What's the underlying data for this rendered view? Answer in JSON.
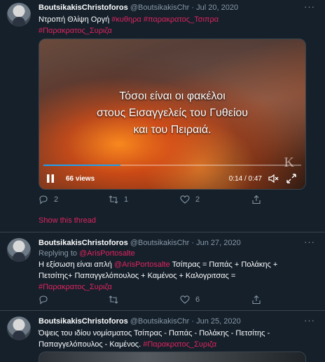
{
  "tweets": [
    {
      "name": "BoutsikakisChristoforos",
      "handle": "@BoutsikakisChr",
      "sep": "·",
      "date": "Jul 20, 2020",
      "text_plain": "Ντροπή Θλίψη Οργή ",
      "tags_line1": "#κυθηρα #παρακρατος_Τσιπρα",
      "tags_line2": "#Παρακρατος_Συριζα",
      "video": {
        "overlay_line1": "Τόσοι είναι οι φακέλοι",
        "overlay_line2": "στους Εισαγγελείς του Γυθείου",
        "overlay_line3": "και του Πειραιά.",
        "views": "66 views",
        "time": "0:14 / 0:47",
        "watermark": "K",
        "progress": 0.3
      },
      "replies": "2",
      "retweets": "1",
      "likes": "2",
      "show_thread": "Show this thread"
    },
    {
      "name": "BoutsikakisChristoforos",
      "handle": "@BoutsikakisChr",
      "sep": "·",
      "date": "Jun 27, 2020",
      "replying_prefix": "Replying to ",
      "replying_to": "@ArisPortosalte",
      "text_a": "Η εξίσωση είναι απλή ",
      "text_mention": "@ArisPortosalte",
      "text_b": " Τσίπρας = Παπάς + Πολάκης +",
      "text_line2": "Πετσίτης+ Παπαγγελόπουλος + Καμένος + Καλογριτσας =",
      "text_tag": "#Παρακρατος_Συριζα",
      "replies": "",
      "retweets": "",
      "likes": "6"
    },
    {
      "name": "BoutsikakisChristoforos",
      "handle": "@BoutsikakisChr",
      "sep": "·",
      "date": "Jun 25, 2020",
      "text_line1": "Όψεις του ιδίου νομίσματος Τσίπρας - Παπάς - Πολάκης - Πετσίτης -",
      "text_line2": "Παπαγγελόπουλος - Καμένος. ",
      "text_tag": "#Παρακρατος_Συριζα"
    }
  ],
  "colors": {
    "background": "#15202b",
    "accent": "#e0245e",
    "muted": "#8899a6",
    "divider": "#38444d"
  }
}
